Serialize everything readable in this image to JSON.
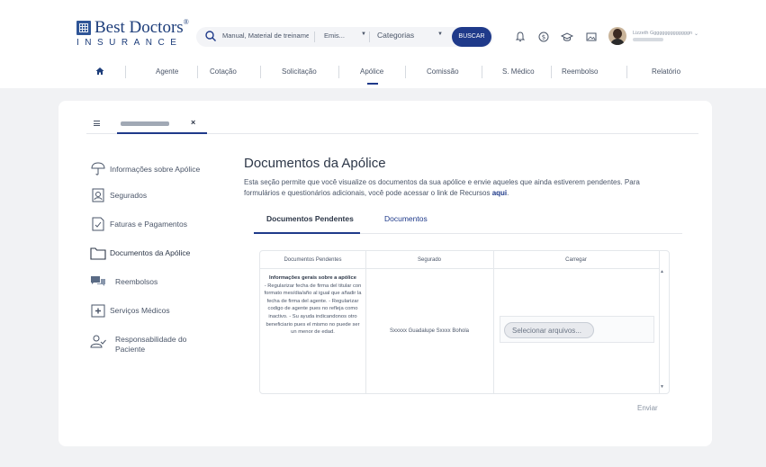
{
  "brand": {
    "name": "Best Doctors",
    "sub": "INSURANCE",
    "reg": "®"
  },
  "search": {
    "query": "Manual, Material de treinamento",
    "type": "Emis...",
    "category": "Categorias",
    "button": "BUSCAR"
  },
  "header_icons": [
    "bell-icon",
    "dollar-icon",
    "graduation-cap-icon",
    "image-icon"
  ],
  "user": {
    "name": "Lizzeth Ggggggggggggggn"
  },
  "nav": [
    {
      "label": "Agente"
    },
    {
      "label": "Cotação"
    },
    {
      "label": "Solicitação"
    },
    {
      "label": "Apólice"
    },
    {
      "label": "Comissão"
    },
    {
      "label": "S. Médico"
    },
    {
      "label": "Reembolso"
    },
    {
      "label": "Relatório"
    }
  ],
  "sidebar": [
    {
      "label": "Informações sobre Apólice",
      "icon": "umbrella-icon"
    },
    {
      "label": "Segurados",
      "icon": "user-square-icon"
    },
    {
      "label": "Faturas e Pagamentos",
      "icon": "file-check-icon"
    },
    {
      "label": "Documentos da Apólice",
      "icon": "folder-icon"
    },
    {
      "label": "Reembolsos",
      "icon": "chat-bubbles-icon"
    },
    {
      "label": "Serviços Médicos",
      "icon": "medical-plus-icon"
    },
    {
      "label": "Responsabilidade do",
      "label2": "Paciente",
      "icon": "user-check-icon"
    }
  ],
  "content": {
    "title": "Documentos da Apólice",
    "desc": "Esta seção permite que você visualize os documentos da sua apólice e envie aqueles que ainda estiverem pendentes. Para formulários e questionários adicionais, você pode acessar o link de Recursos ",
    "desc_link": "aqui",
    "desc_end": "."
  },
  "doc_tabs": {
    "pending": "Documentos Pendentes",
    "docs": "Documentos"
  },
  "table": {
    "headers": [
      "Documentos Pendentes",
      "Segurado",
      "Carregar"
    ],
    "row": {
      "req_title": "Informações gerais sobre a apólice",
      "req_body": "- Regularizar fecha de firma del titular con formato mes/dia/año al igual que añadir la fecha de firma del agente. - Regularizar codigo de agente pues no refleja como inactivo. - Su ayuda indicandonos otro beneficiario pues el mismo no puede ser un menor de edad.",
      "insured": "Sxxxxx Guadalupe Sxxxx Bohola",
      "upload": "Selecionar arquivos..."
    }
  },
  "send_button": "Enviar",
  "colors": {
    "primary": "#1f3a8a",
    "bg": "#f1f2f4"
  }
}
